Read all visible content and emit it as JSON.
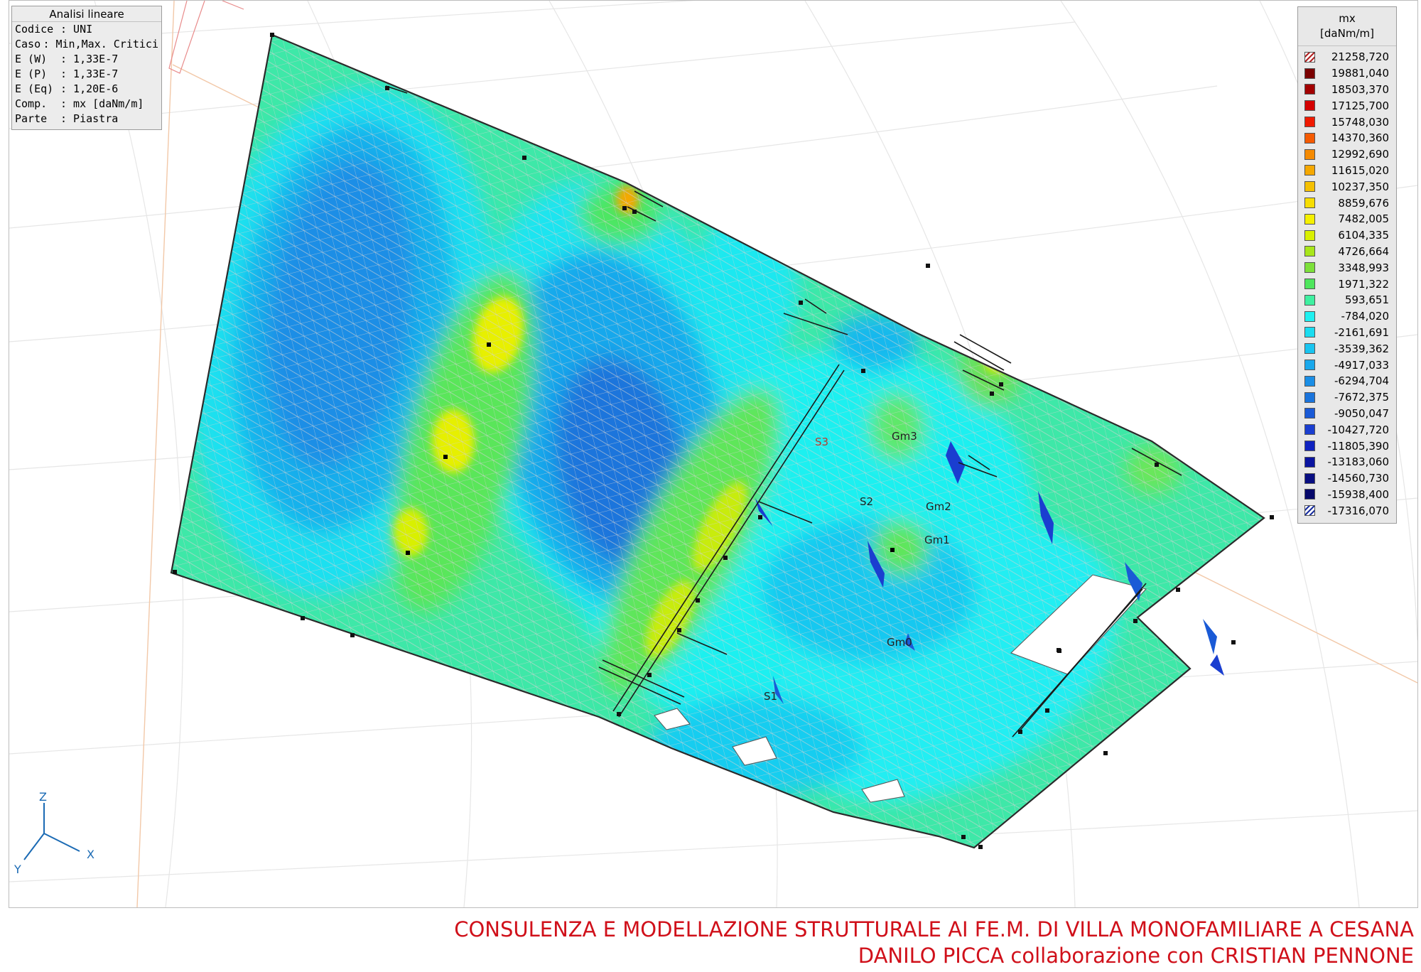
{
  "info_panel": {
    "title": "Analisi lineare",
    "rows": [
      {
        "key": "Codice",
        "value": ": UNI"
      },
      {
        "key": "Caso",
        "value": ": Min,Max. Critici"
      },
      {
        "key": "E (W)",
        "value": ": 1,33E-7"
      },
      {
        "key": "E (P)",
        "value": ": 1,33E-7"
      },
      {
        "key": "E (Eq)",
        "value": ": 1,20E-6"
      },
      {
        "key": "Comp.",
        "value": ": mx [daNm/m]"
      },
      {
        "key": "Parte",
        "value": ": Piastra"
      }
    ]
  },
  "legend": {
    "title": "mx",
    "unit": "[daNm/m]",
    "entries": [
      {
        "value": "21258,720",
        "color": "#ffffff",
        "pattern": "hatch-red"
      },
      {
        "value": "19881,040",
        "color": "#7a0000"
      },
      {
        "value": "18503,370",
        "color": "#a30000"
      },
      {
        "value": "17125,700",
        "color": "#d40000"
      },
      {
        "value": "15748,030",
        "color": "#f01a00"
      },
      {
        "value": "14370,360",
        "color": "#f55a00"
      },
      {
        "value": "12992,690",
        "color": "#f58a00"
      },
      {
        "value": "11615,020",
        "color": "#f5a800"
      },
      {
        "value": "10237,350",
        "color": "#f5c000"
      },
      {
        "value": "8859,676",
        "color": "#f7dd00"
      },
      {
        "value": "7482,005",
        "color": "#f5f000"
      },
      {
        "value": "6104,335",
        "color": "#d9f000"
      },
      {
        "value": "4726,664",
        "color": "#a8e61a"
      },
      {
        "value": "3348,993",
        "color": "#7de03a"
      },
      {
        "value": "1971,322",
        "color": "#4ee65c"
      },
      {
        "value": "593,651",
        "color": "#3ef0a0"
      },
      {
        "value": "-784,020",
        "color": "#1ff0f0"
      },
      {
        "value": "-2161,691",
        "color": "#1adcf0"
      },
      {
        "value": "-3539,362",
        "color": "#19c4f0"
      },
      {
        "value": "-4917,033",
        "color": "#19a8ec"
      },
      {
        "value": "-6294,704",
        "color": "#1a8ee6"
      },
      {
        "value": "-7672,375",
        "color": "#1a74dc"
      },
      {
        "value": "-9050,047",
        "color": "#1a5ad6"
      },
      {
        "value": "-10427,720",
        "color": "#1a3ed0"
      },
      {
        "value": "-11805,390",
        "color": "#0f22c0"
      },
      {
        "value": "-13183,060",
        "color": "#0a14a0"
      },
      {
        "value": "-14560,730",
        "color": "#080e82"
      },
      {
        "value": "-15938,400",
        "color": "#06086a"
      },
      {
        "value": "-17316,070",
        "color": "#ffffff",
        "pattern": "hatch-blue"
      }
    ]
  },
  "labels": {
    "s3": "S3",
    "s2": "S2",
    "s1": "S1",
    "gm3": "Gm3",
    "gm2": "Gm2",
    "gm1": "Gm1",
    "gm0": "Gm0"
  },
  "axes": {
    "z": "Z",
    "x": "X",
    "y": "Y"
  },
  "footer": {
    "line1": "CONSULENZA E MODELLAZIONE STRUTTURALE AI FE.M. DI VILLA MONOFAMILIARE A CESANA",
    "line2": "DANILO PICCA collaborazione con CRISTIAN PENNONE"
  },
  "colors": {
    "plate_base": "#45e8b8",
    "mesh": "#c8c8c8",
    "footer": "#d0101a"
  }
}
